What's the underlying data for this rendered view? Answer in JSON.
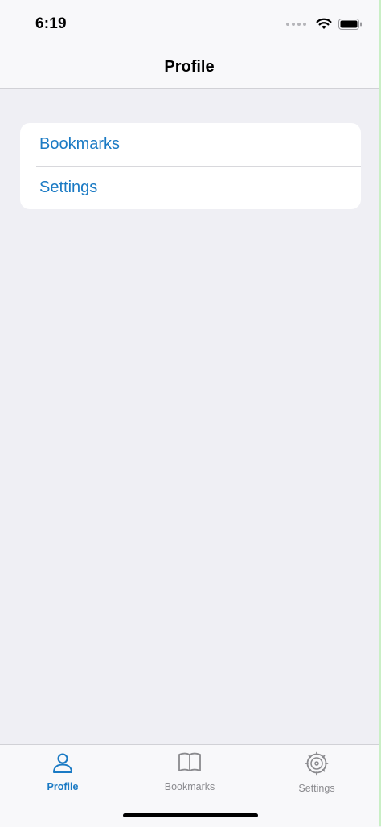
{
  "status_bar": {
    "time": "6:19"
  },
  "nav": {
    "title": "Profile"
  },
  "list": {
    "items": [
      {
        "label": "Bookmarks"
      },
      {
        "label": "Settings"
      }
    ]
  },
  "tab_bar": {
    "tabs": [
      {
        "label": "Profile",
        "icon": "person-icon",
        "active": true
      },
      {
        "label": "Bookmarks",
        "icon": "book-icon",
        "active": false
      },
      {
        "label": "Settings",
        "icon": "gear-icon",
        "active": false
      }
    ]
  },
  "colors": {
    "accent": "#1a7ac4",
    "inactive": "#8a8a8e",
    "background": "#efeff4"
  }
}
